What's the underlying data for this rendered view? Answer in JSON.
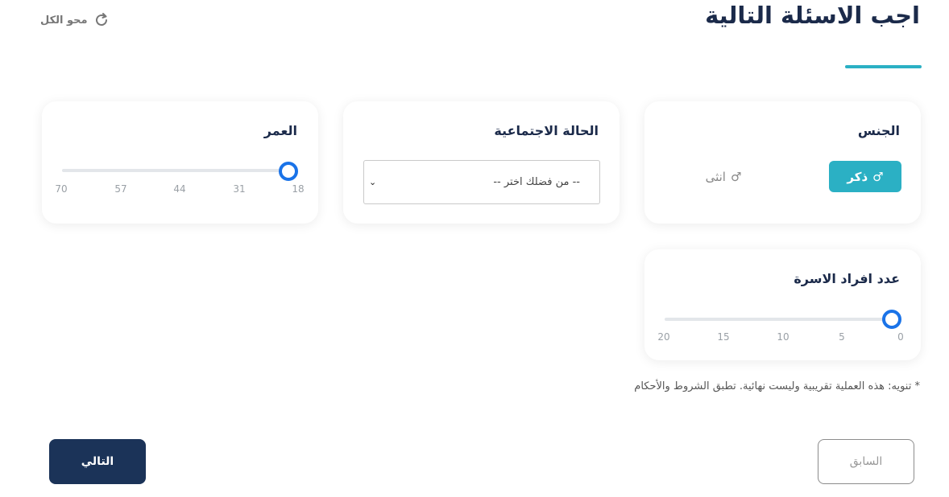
{
  "header": {
    "title": "اجب الاسئلة التالية",
    "clear_all_label": "محو الكل",
    "clear_all_icon": "refresh-icon"
  },
  "gender": {
    "label": "الجنس",
    "options": [
      {
        "label": "ذكر",
        "icon": "male-icon",
        "selected": true
      },
      {
        "label": "انثى",
        "icon": "female-icon",
        "selected": false
      }
    ]
  },
  "marital": {
    "label": "الحالة الاجتماعية",
    "selected_value": "-- من فضلك اختر --"
  },
  "age": {
    "label": "العمر",
    "ticks": [
      "18",
      "31",
      "44",
      "57",
      "70"
    ],
    "min": 18,
    "max": 70,
    "value": 18
  },
  "family": {
    "label": "عدد افراد الاسرة",
    "ticks": [
      "0",
      "5",
      "10",
      "15",
      "20"
    ],
    "min": 0,
    "max": 20,
    "value": 0
  },
  "notice": "* تنويه: هذه العملية تقريبية وليست نهائية. تطبق الشروط والأحكام",
  "nav": {
    "next_label": "التالي",
    "prev_label": "السابق"
  },
  "colors": {
    "accent": "#2bb0c4",
    "primary": "#1b3358",
    "slider": "#1a73e8"
  }
}
